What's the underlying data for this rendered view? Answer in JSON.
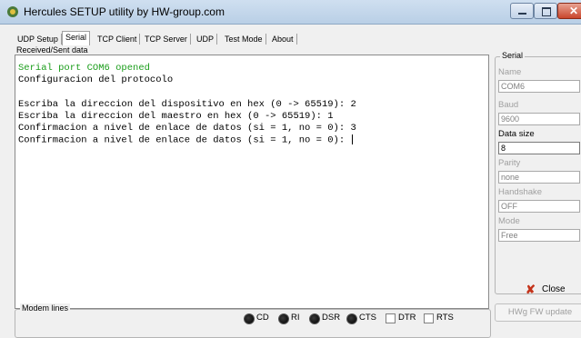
{
  "window": {
    "title": "Hercules SETUP utility by HW-group.com"
  },
  "tabs": [
    {
      "label": "UDP Setup"
    },
    {
      "label": "Serial"
    },
    {
      "label": "TCP Client"
    },
    {
      "label": "TCP Server"
    },
    {
      "label": "UDP"
    },
    {
      "label": "Test Mode"
    },
    {
      "label": "About"
    }
  ],
  "received": {
    "label": "Received/Sent data",
    "lines": [
      "Serial port COM6 opened",
      "Configuracion del protocolo",
      "",
      "Escriba la direccion del dispositivo en hex (0 -> 65519): 2",
      "Escriba la direccion del maestro en hex (0 -> 65519): 1",
      "Confirmacion a nivel de enlace de datos (si = 1, no = 0): 3",
      "Confirmacion a nivel de enlace de datos (si = 1, no = 0): "
    ]
  },
  "modem": {
    "title": "Modem lines",
    "leds": [
      "CD",
      "RI",
      "DSR",
      "CTS"
    ],
    "checks": [
      "DTR",
      "RTS"
    ]
  },
  "serial": {
    "title": "Serial",
    "name_label": "Name",
    "name_value": "COM6",
    "baud_label": "Baud",
    "baud_value": "9600",
    "datasize_label": "Data size",
    "datasize_value": "8",
    "parity_label": "Parity",
    "parity_value": "none",
    "handshake_label": "Handshake",
    "handshake_value": "OFF",
    "mode_label": "Mode",
    "mode_value": "Free"
  },
  "buttons": {
    "close": "Close",
    "hwg_update": "HWg FW update"
  },
  "colors": {
    "terminal_green": "#1a9d1a",
    "titlebar": "#b9cfe6"
  }
}
